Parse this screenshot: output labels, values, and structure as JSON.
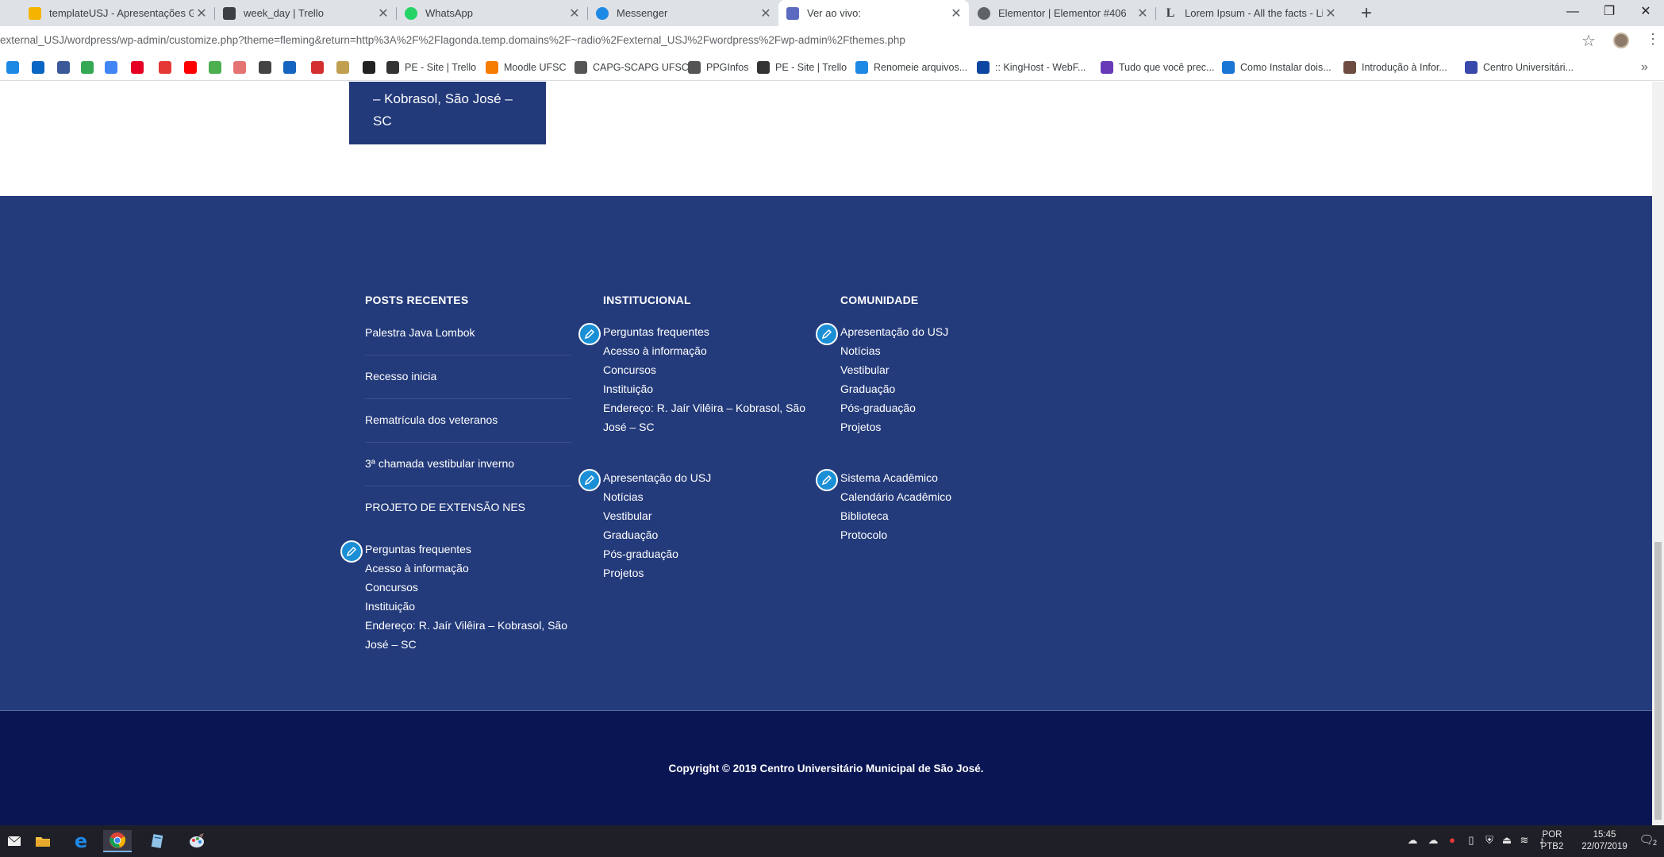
{
  "browser": {
    "tabs": [
      {
        "title": "templateUSJ - Apresentações Go",
        "favicon": "slides-icon",
        "color": "#f4b400"
      },
      {
        "title": "week_day | Trello",
        "favicon": "trello-icon",
        "color": "#3c4043"
      },
      {
        "title": "WhatsApp",
        "favicon": "whatsapp-icon",
        "color": "#25d366"
      },
      {
        "title": "Messenger",
        "favicon": "messenger-icon",
        "color": "#1e88e5"
      },
      {
        "title": "Ver ao vivo:",
        "favicon": "usj-icon",
        "color": "#5c6bc0"
      },
      {
        "title": "Elementor | Elementor #406",
        "favicon": "globe-icon",
        "color": "#5f6368"
      },
      {
        "title": "Lorem Ipsum - All the facts - Lipsu",
        "favicon": "lipsum-icon",
        "color": "#3c4043"
      }
    ],
    "url": "external_USJ/wordpress/wp-admin/customize.php?theme=fleming&return=http%3A%2F%2Flagonda.temp.domains%2F~radio%2Fexternal_USJ%2Fwordpress%2Fwp-admin%2Fthemes.php",
    "bookmarks": [
      {
        "label": "",
        "icon": "messenger-icon",
        "color": "#1e88e5"
      },
      {
        "label": "",
        "icon": "linkedin-icon",
        "color": "#0a66c2"
      },
      {
        "label": "",
        "icon": "facebook-icon",
        "color": "#3b5998"
      },
      {
        "label": "",
        "icon": "maps-icon",
        "color": "#34a853"
      },
      {
        "label": "",
        "icon": "translate-icon",
        "color": "#4285f4"
      },
      {
        "label": "",
        "icon": "pinterest-icon",
        "color": "#e60023"
      },
      {
        "label": "",
        "icon": "scribd-icon",
        "color": "#e53935"
      },
      {
        "label": "",
        "icon": "youtube-icon",
        "color": "#ff0000"
      },
      {
        "label": "",
        "icon": "chrome-icon",
        "color": "#4caf50"
      },
      {
        "label": "",
        "icon": "spiral-icon",
        "color": "#e57373"
      },
      {
        "label": "",
        "icon": "github-icon",
        "color": "#444444"
      },
      {
        "label": "",
        "icon": "link-icon",
        "color": "#1565c0"
      },
      {
        "label": "",
        "icon": "acrobat-icon",
        "color": "#d32f2f"
      },
      {
        "label": "",
        "icon": "coin-icon",
        "color": "#c0a050"
      },
      {
        "label": "",
        "icon": "edu-icon",
        "color": "#222222"
      },
      {
        "label": "PE - Site | Trello",
        "icon": "trello-icon",
        "color": "#333333"
      },
      {
        "label": "Moodle UFSC",
        "icon": "moodle-icon",
        "color": "#f57c00"
      },
      {
        "label": "CAPG-SCAPG UFSC",
        "icon": "globe-icon",
        "color": "#555555"
      },
      {
        "label": "PPGInfos",
        "icon": "globe-icon",
        "color": "#555555"
      },
      {
        "label": "PE - Site | Trello",
        "icon": "trello-icon",
        "color": "#333333"
      },
      {
        "label": "Renomeie arquivos...",
        "icon": "rename-icon",
        "color": "#1e88e5"
      },
      {
        "label": ":: KingHost - WebF...",
        "icon": "kinghost-icon",
        "color": "#0d47a1"
      },
      {
        "label": "Tudo que você prec...",
        "icon": "bookmark-icon",
        "color": "#673ab7"
      },
      {
        "label": "Como Instalar dois...",
        "icon": "bookmark-icon",
        "color": "#1976d2"
      },
      {
        "label": "Introdução à Infor...",
        "icon": "bookmark-icon",
        "color": "#6d4c41"
      },
      {
        "label": "Centro Universitári...",
        "icon": "usj-icon",
        "color": "#3949ab"
      }
    ]
  },
  "page": {
    "address_card": {
      "line1": "– Kobrasol, São José –",
      "line2": "SC"
    },
    "footer": {
      "posts": {
        "title": "POSTS RECENTES",
        "items": [
          "Palestra Java Lombok",
          "Recesso inicia",
          "Rematrícula dos veteranos",
          "3ª chamada vestibular inverno",
          "PROJETO DE EXTENSÃO NES"
        ],
        "menu": [
          "Perguntas frequentes",
          "Acesso à informação",
          "Concursos",
          "Instituição",
          "Endereço: R. Jaír Vilêira – Kobrasol, São",
          "José – SC"
        ]
      },
      "institucional": {
        "title": "INSTITUCIONAL",
        "menu1": [
          "Perguntas frequentes",
          "Acesso à informação",
          "Concursos",
          "Instituição",
          "Endereço: R. Jaír Vilêira – Kobrasol, São",
          "José – SC"
        ],
        "menu2": [
          "Apresentação do USJ",
          "Notícias",
          "Vestibular",
          "Graduação",
          "Pós-graduação",
          "Projetos"
        ]
      },
      "comunidade": {
        "title": "COMUNIDADE",
        "menu1": [
          "Apresentação do USJ",
          "Notícias",
          "Vestibular",
          "Graduação",
          "Pós-graduação",
          "Projetos"
        ],
        "menu2": [
          "Sistema Acadêmico",
          "Calendário Acadêmico",
          "Biblioteca",
          "Protocolo"
        ]
      },
      "copyright": "Copyright © 2019 Centro Universitário Municipal de São José."
    }
  },
  "taskbar": {
    "apps": [
      "mail-icon",
      "file-explorer-icon",
      "edge-icon",
      "chrome-icon",
      "notepad-icon",
      "paint-icon"
    ],
    "language": "POR",
    "layout": "PTB2",
    "time": "15:45",
    "date": "22/07/2019",
    "notification_count": "2"
  },
  "colors": {
    "footer_main": "#243b7b",
    "footer_bottom": "#0a1653",
    "edit_pencil": "#1a8fd6"
  }
}
